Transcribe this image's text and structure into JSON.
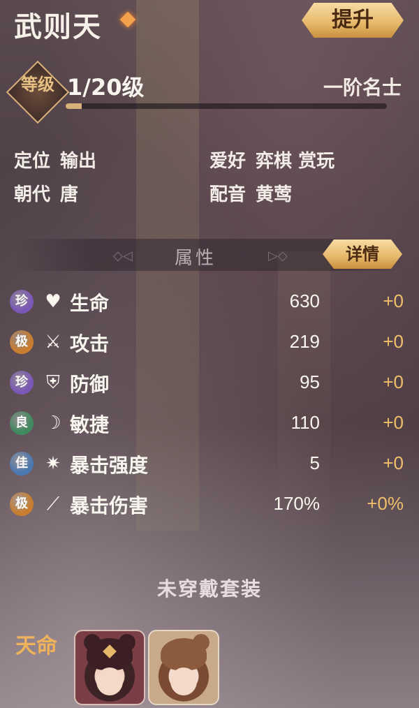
{
  "hero": {
    "name": "武则天",
    "upgrade_label": "提升",
    "level_badge": "等级",
    "level_text": "1/20级",
    "level_progress": 0.05,
    "rank": "一阶名士"
  },
  "info": {
    "position_label": "定位",
    "position_value": "输出",
    "dynasty_label": "朝代",
    "dynasty_value": "唐",
    "hobby_label": "爱好",
    "hobby_value": "弈棋 赏玩",
    "voice_label": "配音",
    "voice_value": "黄莺"
  },
  "attributes": {
    "title": "属性",
    "detail_label": "详情",
    "stats": [
      {
        "grade": "珍",
        "grade_color": "#7a58b8",
        "icon": "heart-icon",
        "icon_glyph": "♥",
        "name": "生命",
        "value": "630",
        "bonus": "+0"
      },
      {
        "grade": "极",
        "grade_color": "#c97d2e",
        "icon": "sword-icon",
        "icon_glyph": "⚔",
        "name": "攻击",
        "value": "219",
        "bonus": "+0"
      },
      {
        "grade": "珍",
        "grade_color": "#7a58b8",
        "icon": "shield-icon",
        "icon_glyph": "⛨",
        "name": "防御",
        "value": "95",
        "bonus": "+0"
      },
      {
        "grade": "良",
        "grade_color": "#3f8a5e",
        "icon": "crescent-icon",
        "icon_glyph": "☽",
        "name": "敏捷",
        "value": "110",
        "bonus": "+0"
      },
      {
        "grade": "佳",
        "grade_color": "#4a78b0",
        "icon": "star-burst-icon",
        "icon_glyph": "✷",
        "name": "暴击强度",
        "value": "5",
        "bonus": "+0"
      },
      {
        "grade": "极",
        "grade_color": "#c97d2e",
        "icon": "slash-icon",
        "icon_glyph": "⟋",
        "name": "暴击伤害",
        "value": "170%",
        "bonus": "+0%"
      }
    ]
  },
  "set": {
    "status": "未穿戴套装"
  },
  "fate": {
    "label": "天命"
  },
  "colors": {
    "accent_gold": "#e6b86a",
    "bonus_orange": "#f0bf6a"
  }
}
